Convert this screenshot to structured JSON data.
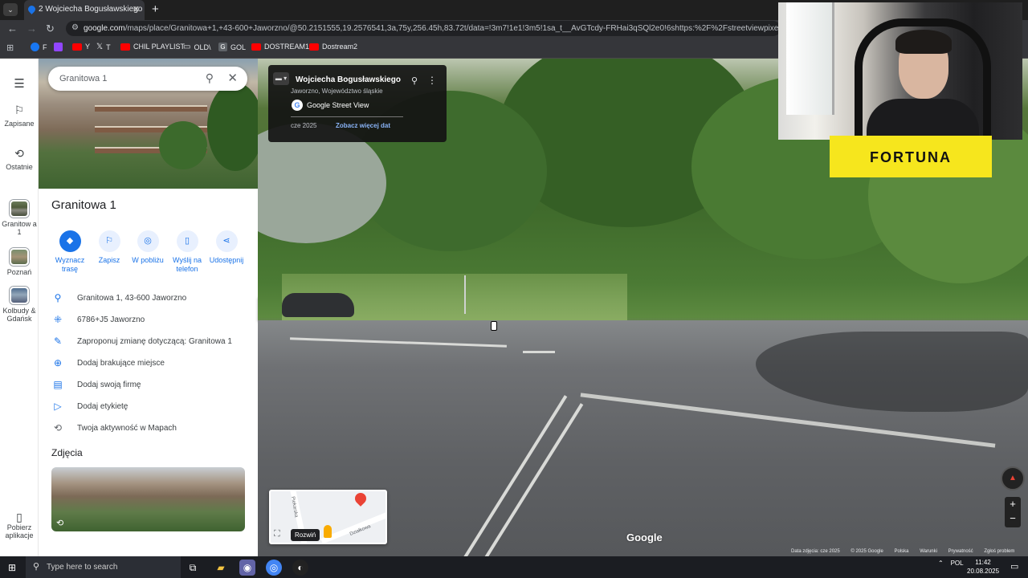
{
  "browser": {
    "tab_title": "2 Wojciecha Bogusławskiego –",
    "new_tab": "+",
    "url_host": "google.com",
    "url_path": "/maps/place/Granitowa+1,+43-600+Jaworzno/@50.2151555,19.2576541,3a,75y,256.45h,83.72t/data=!3m7!1e1!3m5!1sa_t__AvGTcdy-FRHai3qSQl2e0!6shttps:%2F%2Fstreetviewpixels-pa.googleapis.co",
    "bookmarks": [
      {
        "label": "F",
        "icon": "facebook-icon",
        "color": "#1877f2"
      },
      {
        "label": "",
        "icon": "twitch-icon",
        "color": "#9146ff"
      },
      {
        "label": "Y",
        "icon": "youtube-icon",
        "color": "#ff0000"
      },
      {
        "label": "T",
        "icon": "x-icon",
        "color": "#000000"
      },
      {
        "label": "CHIL PLAYLIST",
        "icon": "youtube-icon",
        "color": "#ff0000"
      },
      {
        "label": "OLD\\",
        "icon": "folder-icon",
        "color": "#e8eaed"
      },
      {
        "label": "GOL",
        "icon": "g-icon",
        "color": "#5f6368"
      },
      {
        "label": "DOSTREAM1",
        "icon": "youtube-icon",
        "color": "#ff0000"
      },
      {
        "label": "Dostream2",
        "icon": "youtube-icon",
        "color": "#ff0000"
      }
    ]
  },
  "rail": {
    "saved": "Zapisane",
    "recent": "Ostatnie",
    "recent_place_1": "Granitow a 1",
    "explore": "Poznań",
    "recent_place_2": "Kolbudy & Gdańsk",
    "get_app": "Pobierz aplikacje"
  },
  "panel": {
    "search_value": "Granitowa 1",
    "title": "Granitowa 1",
    "actions": [
      {
        "label": "Wyznacz trasę",
        "icon": "directions-icon"
      },
      {
        "label": "Zapisz",
        "icon": "bookmark-icon"
      },
      {
        "label": "W pobliżu",
        "icon": "nearby-icon"
      },
      {
        "label": "Wyślij na telefon",
        "icon": "phone-icon"
      },
      {
        "label": "Udostępnij",
        "icon": "share-icon"
      }
    ],
    "info": [
      {
        "text": "Granitowa 1, 43-600 Jaworzno",
        "icon": "location-pin-icon"
      },
      {
        "text": "6786+J5 Jaworzno",
        "icon": "plus-code-icon"
      },
      {
        "text": "Zaproponuj zmianę dotyczącą: Granitowa 1",
        "icon": "pencil-icon"
      },
      {
        "text": "Dodaj brakujące miejsce",
        "icon": "add-place-icon"
      },
      {
        "text": "Dodaj swoją firmę",
        "icon": "store-icon"
      },
      {
        "text": "Dodaj etykietę",
        "icon": "label-icon"
      },
      {
        "text": "Twoja aktywność w Mapach",
        "icon": "history-icon"
      }
    ],
    "photos_heading": "Zdjęcia"
  },
  "streetview": {
    "street": "Wojciecha Bogusławskiego",
    "locality": "Jaworzno, Województwo śląskie",
    "brand": "Google Street View",
    "date": "cze 2025",
    "see_more": "Zobacz więcej dat",
    "minimap_street_1": "Piekarska",
    "minimap_street_2": "Działkowa",
    "expand": "Rozwiń",
    "logo": "Google",
    "credits": [
      "Data zdjęcia: cze 2025",
      "© 2025 Google",
      "Polska",
      "Warunki",
      "Prywatność",
      "Zgłoś problem"
    ]
  },
  "overlay": {
    "sponsor": "FORTUNA"
  },
  "taskbar": {
    "search_placeholder": "Type here to search",
    "language": "POL",
    "time": "11:42",
    "date": "20.08.2025"
  }
}
